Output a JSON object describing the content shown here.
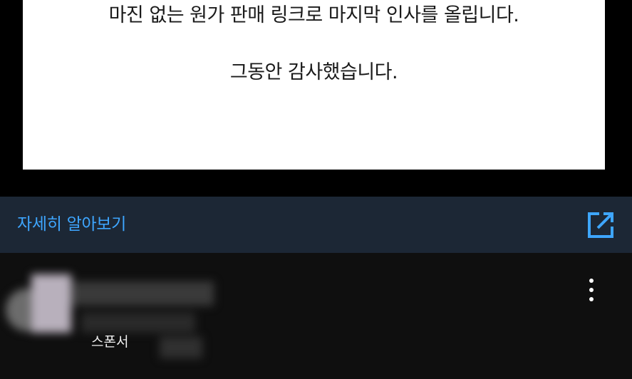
{
  "ad": {
    "line1": "마진 없는 원가 판매 링크로 마지막 인사를 올립니다.",
    "line2": "그동안 감사했습니다."
  },
  "cta": {
    "label": "자세히 알아보기",
    "icon": "open-in-new-icon",
    "accent_color": "#3ea6ff",
    "background_color": "#1c2735"
  },
  "advertiser": {
    "sponsor_label": "스폰서"
  },
  "menu": {
    "icon": "more-vertical-icon"
  }
}
